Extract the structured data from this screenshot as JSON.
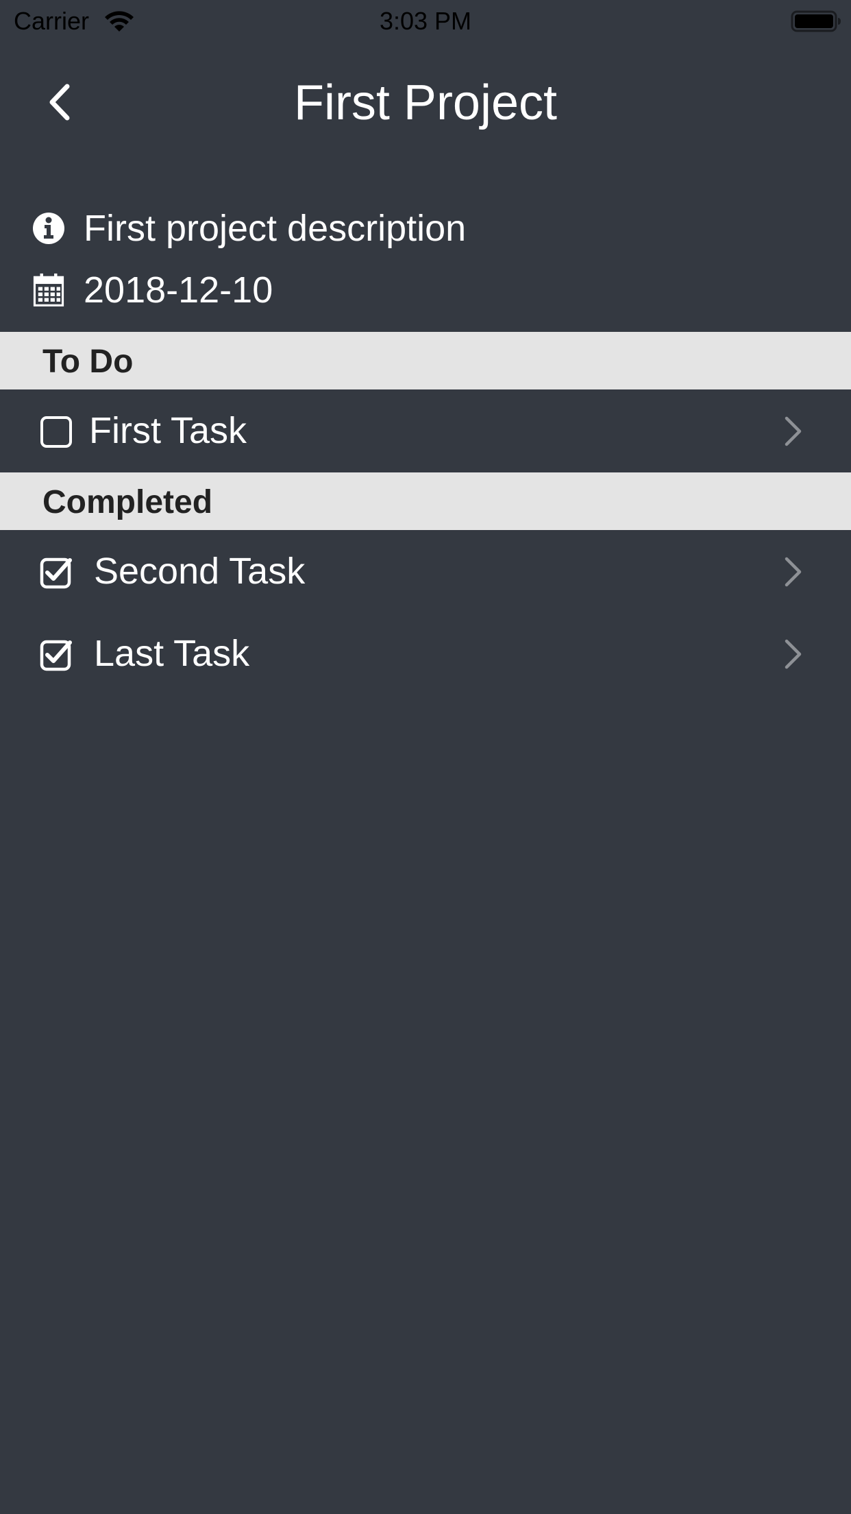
{
  "status_bar": {
    "carrier": "Carrier",
    "time": "3:03 PM",
    "wifi_icon": "wifi-icon",
    "battery_icon": "battery-icon"
  },
  "nav": {
    "title": "First Project",
    "back_icon": "chevron-left-icon"
  },
  "project": {
    "description": "First project description",
    "date": "2018-12-10",
    "description_icon": "info-circle-icon",
    "date_icon": "calendar-icon"
  },
  "sections": {
    "todo": {
      "label": "To Do",
      "tasks": [
        {
          "label": "First Task",
          "completed": false
        }
      ]
    },
    "completed": {
      "label": "Completed",
      "tasks": [
        {
          "label": "Second Task",
          "completed": true
        },
        {
          "label": "Last Task",
          "completed": true
        }
      ]
    }
  },
  "colors": {
    "background": "#343941",
    "section_header_bg": "#e4e4e4",
    "section_header_text": "#222222",
    "text": "#ffffff",
    "chevron": "#8e9196"
  }
}
